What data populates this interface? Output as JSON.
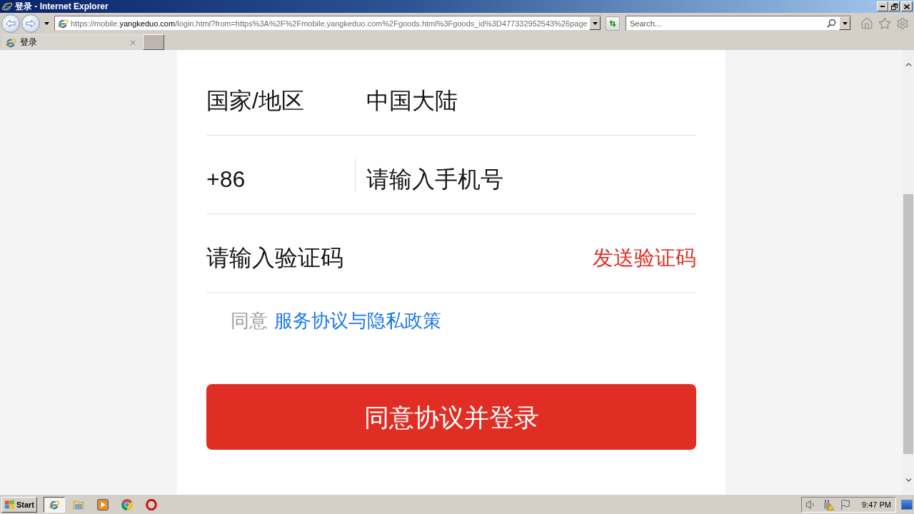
{
  "window": {
    "title": "登录 - Internet Explorer"
  },
  "address_bar": {
    "url": "https://mobile.**yangkeduo.com**/login.html?from=https%3A%2F%2Fmobile.yangkeduo.com%2Fgoods.html%3Fgoods_id%3D477332952543%26page"
  },
  "search": {
    "placeholder": "Search..."
  },
  "tabs": [
    {
      "label": "登录",
      "selected": true
    }
  ],
  "form": {
    "region": {
      "label": "国家/地区",
      "value": "中国大陆"
    },
    "phone": {
      "prefix": "+86",
      "placeholder": "请输入手机号"
    },
    "code": {
      "placeholder": "请输入验证码",
      "send_button": "发送验证码"
    },
    "agreement": {
      "text": "同意",
      "link": "服务协议与隐私政策"
    },
    "submit": "同意协议并登录"
  },
  "taskbar": {
    "start": "Start",
    "apps": [
      {
        "selected": true
      },
      {
        "selected": false
      },
      {
        "selected": false
      },
      {
        "selected": false
      },
      {
        "selected": false
      }
    ],
    "clock": "9:47 PM"
  }
}
